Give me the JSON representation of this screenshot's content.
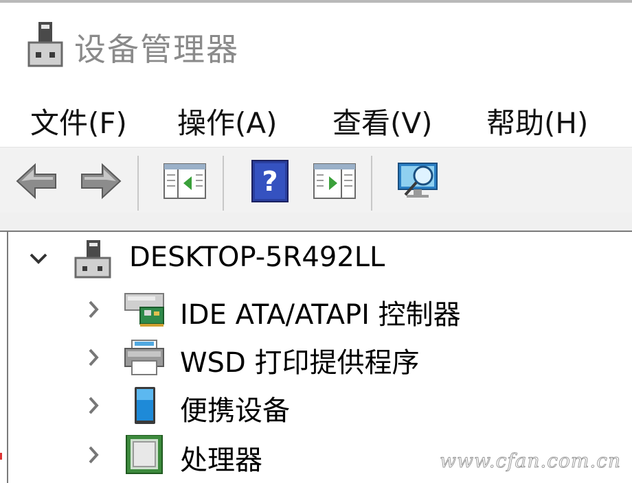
{
  "window": {
    "title": "设备管理器",
    "title_icon": "device-manager-icon"
  },
  "menu": {
    "items": [
      {
        "label": "文件(F)"
      },
      {
        "label": "操作(A)"
      },
      {
        "label": "查看(V)"
      },
      {
        "label": "帮助(H)"
      }
    ]
  },
  "toolbar": {
    "buttons": [
      {
        "icon": "back-arrow-icon"
      },
      {
        "icon": "forward-arrow-icon"
      },
      {
        "icon": "show-hide-console-tree-icon"
      },
      {
        "icon": "help-icon"
      },
      {
        "icon": "show-action-pane-icon"
      },
      {
        "icon": "scan-hardware-changes-icon"
      }
    ]
  },
  "tree": {
    "root": {
      "label": "DESKTOP-5R492LL",
      "expanded": true,
      "icon": "computer-icon"
    },
    "children": [
      {
        "label": "IDE ATA/ATAPI 控制器",
        "icon": "ide-controller-icon"
      },
      {
        "label": "WSD 打印提供程序",
        "icon": "printer-icon"
      },
      {
        "label": "便携设备",
        "icon": "portable-device-icon"
      },
      {
        "label": "处理器",
        "icon": "processor-icon"
      }
    ]
  },
  "watermark": "www.cfan.com.cn",
  "colors": {
    "title_text": "#8a8a8a",
    "toolbar_bg": "#f2f2f2",
    "help_blue": "#2a3f9e",
    "monitor_blue": "#2a7fc4",
    "chip_green": "#3d8a3d"
  }
}
